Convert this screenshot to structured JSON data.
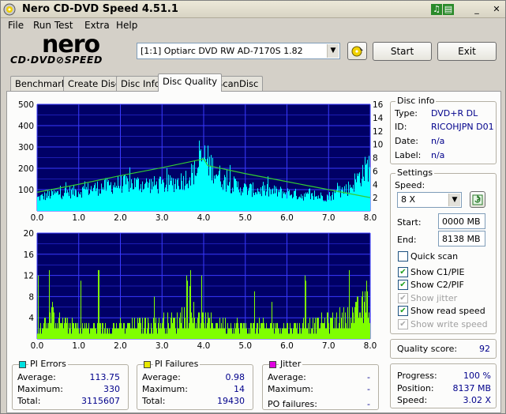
{
  "window": {
    "title": "Nero CD-DVD Speed 4.51.1"
  },
  "menu": [
    "File",
    "Run Test",
    "Extra",
    "Help"
  ],
  "logo": {
    "line1": "nero",
    "line2": "CD·DVD⊘SPEED"
  },
  "drive": {
    "selected": "[1:1]  Optiarc DVD RW AD-7170S 1.82"
  },
  "buttons": {
    "start": "Start",
    "exit": "Exit"
  },
  "tabs": [
    "Benchmark",
    "Create Disc",
    "Disc Info",
    "Disc Quality",
    "ScanDisc"
  ],
  "active_tab": "Disc Quality",
  "disc_info": {
    "title": "Disc info",
    "type_label": "Type:",
    "type": "DVD+R DL",
    "id_label": "ID:",
    "id": "RICOHJPN D01",
    "date_label": "Date:",
    "date": "n/a",
    "label_label": "Label:",
    "label": "n/a"
  },
  "settings": {
    "title": "Settings",
    "speed_label": "Speed:",
    "speed": "8 X",
    "start_label": "Start:",
    "start": "0000 MB",
    "end_label": "End:",
    "end": "8138 MB",
    "quick_scan": "Quick scan",
    "show_c1": "Show C1/PIE",
    "show_c2": "Show C2/PIF",
    "show_jitter": "Show jitter",
    "show_read": "Show read speed",
    "show_write": "Show write speed"
  },
  "quality": {
    "label": "Quality score:",
    "value": "92"
  },
  "progress": {
    "progress_label": "Progress:",
    "progress": "100 %",
    "position_label": "Position:",
    "position": "8137 MB",
    "speed_label": "Speed:",
    "speed": "3.02 X"
  },
  "pi_errors": {
    "title": "PI Errors",
    "color": "#00e0e0",
    "avg_label": "Average:",
    "avg": "113.75",
    "max_label": "Maximum:",
    "max": "330",
    "total_label": "Total:",
    "total": "3115607"
  },
  "pi_failures": {
    "title": "PI Failures",
    "color": "#e8e800",
    "avg_label": "Average:",
    "avg": "0.98",
    "max_label": "Maximum:",
    "max": "14",
    "total_label": "Total:",
    "total": "19430"
  },
  "jitter": {
    "title": "Jitter",
    "color": "#e000e0",
    "avg_label": "Average:",
    "avg": "-",
    "max_label": "Maximum:",
    "max": "-",
    "po_label": "PO failures:",
    "po": "-"
  },
  "colors": {
    "plot_bg": "#000066",
    "grid": "#3a3aff",
    "pie": "#00ffff",
    "pif": "#7fff00",
    "speed_line": "#33cc33"
  },
  "chart_data": [
    {
      "type": "area",
      "name": "PI Errors",
      "x_ticks": [
        "0.0",
        "1.0",
        "2.0",
        "3.0",
        "4.0",
        "5.0",
        "6.0",
        "7.0",
        "8.0"
      ],
      "xlim": [
        0,
        8
      ],
      "ylim_left": [
        0,
        500
      ],
      "y_ticks_left": [
        "100",
        "200",
        "300",
        "400",
        "500"
      ],
      "ylim_right": [
        0,
        16
      ],
      "y_ticks_right": [
        "2",
        "4",
        "6",
        "8",
        "10",
        "12",
        "14",
        "16"
      ],
      "pie_envelope": [
        [
          0,
          70
        ],
        [
          0.3,
          90
        ],
        [
          0.6,
          100
        ],
        [
          1.0,
          110
        ],
        [
          1.5,
          130
        ],
        [
          2.0,
          150
        ],
        [
          2.5,
          150
        ],
        [
          3.0,
          140
        ],
        [
          3.5,
          170
        ],
        [
          3.8,
          220
        ],
        [
          4.0,
          300
        ],
        [
          4.2,
          240
        ],
        [
          4.5,
          160
        ],
        [
          5.0,
          120
        ],
        [
          5.5,
          110
        ],
        [
          6.0,
          100
        ],
        [
          6.5,
          80
        ],
        [
          7.0,
          80
        ],
        [
          7.5,
          130
        ],
        [
          8.0,
          260
        ]
      ],
      "read_speed": [
        [
          0,
          2.8
        ],
        [
          1,
          4.0
        ],
        [
          2,
          5.3
        ],
        [
          3,
          6.5
        ],
        [
          4,
          7.8
        ],
        [
          4.1,
          6.8
        ],
        [
          5,
          5.6
        ],
        [
          6,
          4.4
        ],
        [
          7,
          3.2
        ],
        [
          8,
          2.0
        ]
      ]
    },
    {
      "type": "bar",
      "name": "PI Failures",
      "x_ticks": [
        "0.0",
        "1.0",
        "2.0",
        "3.0",
        "4.0",
        "5.0",
        "6.0",
        "7.0",
        "8.0"
      ],
      "xlim": [
        0,
        8
      ],
      "ylim": [
        0,
        20
      ],
      "y_ticks": [
        "4",
        "8",
        "12",
        "16",
        "20"
      ]
    }
  ]
}
